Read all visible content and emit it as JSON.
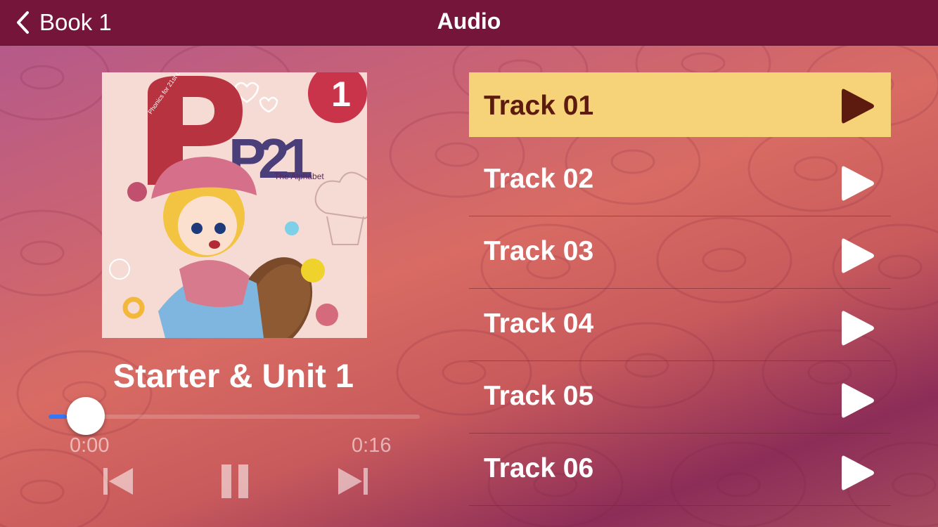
{
  "nav": {
    "back_label": "Book 1",
    "title": "Audio",
    "back_icon": "chevron-left-icon"
  },
  "album": {
    "cover_alt": "P21 Phonics for 21st Century Kids book cover",
    "cover_series": "Phonics for 21st Century Kids",
    "cover_number": "1",
    "cover_logo": "P21",
    "cover_subtitle": "The Alphabet"
  },
  "player": {
    "now_playing": "Starter & Unit 1",
    "current_time": "0:00",
    "duration": "0:16",
    "progress": 0.05,
    "prev_icon": "skip-previous-icon",
    "pause_icon": "pause-icon",
    "next_icon": "skip-next-icon"
  },
  "tracks": [
    {
      "label": "Track 01",
      "active": true
    },
    {
      "label": "Track 02",
      "active": false
    },
    {
      "label": "Track 03",
      "active": false
    },
    {
      "label": "Track 04",
      "active": false
    },
    {
      "label": "Track 05",
      "active": false
    },
    {
      "label": "Track 06",
      "active": false
    }
  ],
  "colors": {
    "navbar": "#75153a",
    "active_track_bg": "#f6d378",
    "active_track_text": "#5c1b0e",
    "progress_fill": "#3478f6"
  }
}
